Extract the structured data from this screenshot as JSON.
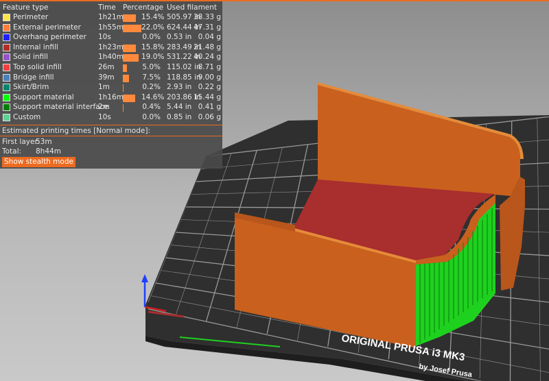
{
  "colors": {
    "accent": "#ed6b21",
    "bar": "#ff8a3d"
  },
  "legend": {
    "headers": {
      "feature": "Feature type",
      "time": "Time",
      "percentage": "Percentage",
      "used": "Used filament"
    },
    "rows": [
      {
        "name": "Perimeter",
        "color": "#ffe64d",
        "time": "1h21m",
        "pct": "15.4%",
        "pct_value": 15.4,
        "in": "505.97 in",
        "g": "38.33 g"
      },
      {
        "name": "External perimeter",
        "color": "#ff7d38",
        "time": "1h55m",
        "pct": "22.0%",
        "pct_value": 22.0,
        "in": "624.44 in",
        "g": "47.31 g"
      },
      {
        "name": "Overhang perimeter",
        "color": "#1f1fff",
        "time": "10s",
        "pct": "0.0%",
        "pct_value": 0.0,
        "in": "0.53 in",
        "g": "0.04 g"
      },
      {
        "name": "Internal infill",
        "color": "#b03029",
        "time": "1h23m",
        "pct": "15.8%",
        "pct_value": 15.8,
        "in": "283.49 in",
        "g": "21.48 g"
      },
      {
        "name": "Solid infill",
        "color": "#9654cc",
        "time": "1h40m",
        "pct": "19.0%",
        "pct_value": 19.0,
        "in": "531.22 in",
        "g": "40.24 g"
      },
      {
        "name": "Top solid infill",
        "color": "#f04040",
        "time": "26m",
        "pct": "5.0%",
        "pct_value": 5.0,
        "in": "115.02 in",
        "g": "8.71 g"
      },
      {
        "name": "Bridge infill",
        "color": "#4d80ba",
        "time": "39m",
        "pct": "7.5%",
        "pct_value": 7.5,
        "in": "118.85 in",
        "g": "9.00 g"
      },
      {
        "name": "Skirt/Brim",
        "color": "#00876e",
        "time": "1m",
        "pct": "0.2%",
        "pct_value": 0.2,
        "in": "2.93 in",
        "g": "0.22 g"
      },
      {
        "name": "Support material",
        "color": "#00ff00",
        "time": "1h16m",
        "pct": "14.6%",
        "pct_value": 14.6,
        "in": "203.86 in",
        "g": "15.44 g"
      },
      {
        "name": "Support material interface",
        "color": "#008000",
        "time": "2m",
        "pct": "0.4%",
        "pct_value": 0.4,
        "in": "5.44 in",
        "g": "0.41 g"
      },
      {
        "name": "Custom",
        "color": "#5ed194",
        "time": "10s",
        "pct": "0.0%",
        "pct_value": 0.0,
        "in": "0.85 in",
        "g": "0.06 g"
      }
    ],
    "estimated_title": "Estimated printing times [Normal mode]:",
    "first_layer_label": "First layer:",
    "first_layer_value": "53m",
    "total_label": "Total:",
    "total_value": "8h44m",
    "stealth_button": "Show stealth mode"
  },
  "bed": {
    "label_line1": "ORIGINAL PRUSA i3 MK3",
    "label_line2": "by Josef Prusa"
  }
}
